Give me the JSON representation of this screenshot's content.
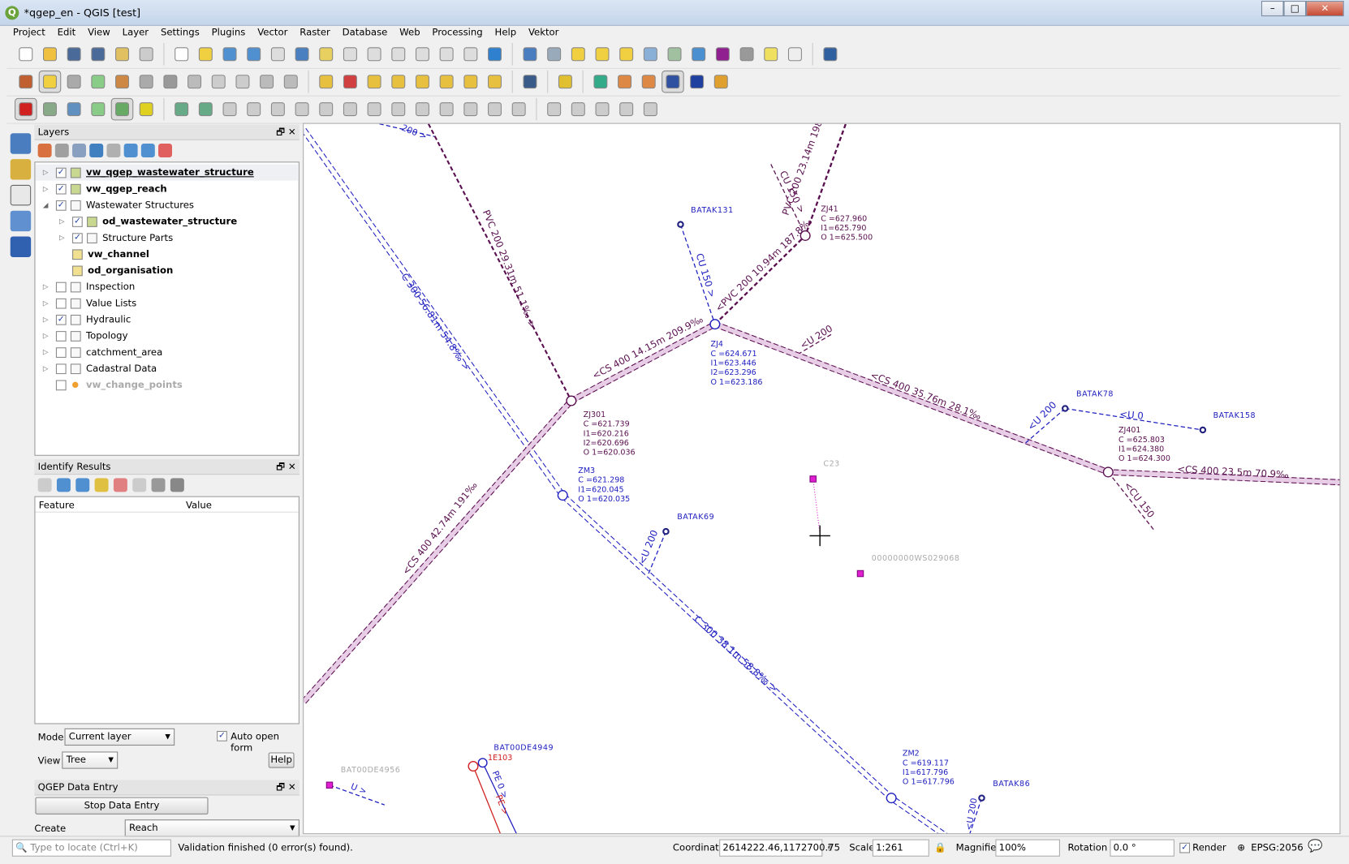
{
  "window": {
    "title": "*qgep_en - QGIS [test]",
    "app_icon": "Q"
  },
  "menu": [
    "Project",
    "Edit",
    "View",
    "Layer",
    "Settings",
    "Plugins",
    "Vector",
    "Raster",
    "Database",
    "Web",
    "Processing",
    "Help",
    "Vektor"
  ],
  "layers_panel": {
    "title": "Layers",
    "items": [
      {
        "label": "vw_qgep_wastewater_structure",
        "checked": true,
        "bold": true,
        "underline": true
      },
      {
        "label": "vw_qgep_reach",
        "checked": true,
        "bold": true
      },
      {
        "label": "Wastewater Structures",
        "checked": true,
        "group": true,
        "expanded": true
      },
      {
        "label": "od_wastewater_structure",
        "checked": true,
        "bold": true
      },
      {
        "label": "Structure Parts",
        "checked": true,
        "group": true
      },
      {
        "label": "vw_channel",
        "bold": true
      },
      {
        "label": "od_organisation",
        "bold": true
      },
      {
        "label": "Inspection",
        "checked": false
      },
      {
        "label": "Value Lists",
        "checked": false
      },
      {
        "label": "Hydraulic",
        "checked": true
      },
      {
        "label": "Topology",
        "checked": false
      },
      {
        "label": "catchment_area",
        "checked": false
      },
      {
        "label": "Cadastral Data",
        "checked": false
      },
      {
        "label": "vw_change_points",
        "checked": false,
        "disabled": true
      }
    ]
  },
  "identify_panel": {
    "title": "Identify Results",
    "col_feature": "Feature",
    "col_value": "Value",
    "mode_label": "Mode",
    "mode_value": "Current layer",
    "auto_open_label": "Auto open form",
    "auto_open_checked": true,
    "view_label": "View",
    "view_value": "Tree",
    "help_label": "Help"
  },
  "qgep_panel": {
    "title": "QGEP Data Entry",
    "stop_label": "Stop Data Entry",
    "create_label": "Create",
    "create_value": "Reach"
  },
  "map": {
    "reach_labels": [
      "200 >",
      "PVC 200 29.31m 51.1‰ >",
      "C 300 56.81m 54.8‰ >",
      "<CS 400 14.15m 209.9‰",
      "<PVC 200 10.94m 187.8‰",
      "PVC 200 23.14m 198.5‰",
      "CU 150 >",
      "CU 150 >",
      "<U 200",
      "<CS 400 35.76m 28.1‰",
      "<U 200",
      "<U 0",
      "<CS 400 23.5m 70.9‰",
      "<CU 150",
      "<U 200",
      "<CS 400 42.74m 191‰",
      "C 300 38.1m 58.8‰ >",
      "U >",
      "PE 0 >",
      "PE >",
      "<U 200"
    ],
    "structures": [
      {
        "name": "ZJ41",
        "lines": [
          "C =627.960",
          "I1=625.790",
          "O 1=625.500"
        ]
      },
      {
        "name": "ZJ4",
        "lines": [
          "C =624.671",
          "I1=623.446",
          "I2=623.296",
          "O 1=623.186"
        ]
      },
      {
        "name": "ZJ301",
        "lines": [
          "C =621.739",
          "I1=620.216",
          "I2=620.696",
          "O 1=620.036"
        ]
      },
      {
        "name": "ZM3",
        "lines": [
          "C =621.298",
          "I1=620.045",
          "O 1=620.035"
        ]
      },
      {
        "name": "ZJ401",
        "lines": [
          "C =625.803",
          "I1=624.380",
          "O 1=624.300"
        ]
      },
      {
        "name": "ZM2",
        "lines": [
          "C =619.117",
          "I1=617.796",
          "O 1=617.796"
        ]
      }
    ],
    "points": [
      "BATAK131",
      "BATAK78",
      "BATAK158",
      "BATAK69",
      "C23",
      "00000000WS029068",
      "BAT00DE4956",
      "BAT00DE4949",
      "BATAK86"
    ],
    "red_label": "1E103",
    "colors": {
      "blue": "#2020c0",
      "purple": "#5a1050",
      "pink_fill": "#e8cde6",
      "magenta": "#e020d0",
      "red": "#d02020"
    }
  },
  "statusbar": {
    "locate_placeholder": "Type to locate (Ctrl+K)",
    "message": "Validation finished (0 error(s) found).",
    "coordinate_label": "Coordinate",
    "coordinate": "2614222.46,1172700.75",
    "scale_label": "Scale",
    "scale": "1:261",
    "magnifier_label": "Magnifier",
    "magnifier": "100%",
    "rotation_label": "Rotation",
    "rotation": "0.0 °",
    "render_label": "Render",
    "render_checked": true,
    "crs": "EPSG:2056"
  }
}
